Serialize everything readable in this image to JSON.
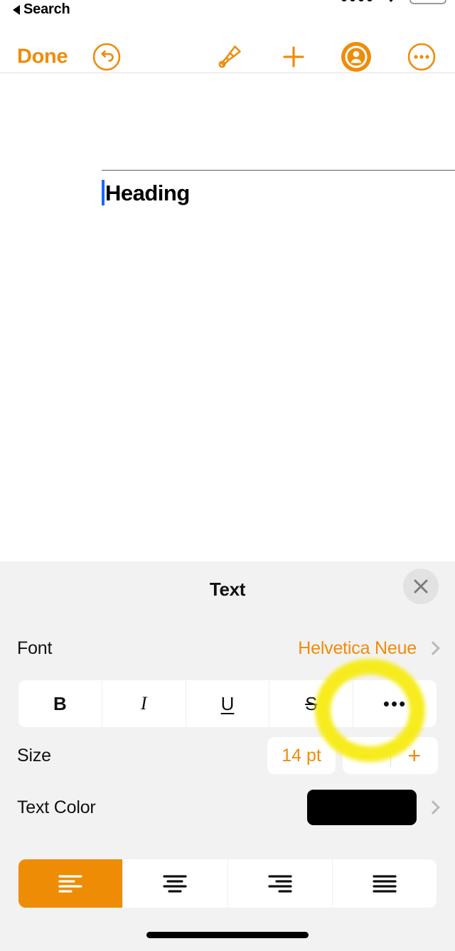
{
  "statusbar": {
    "back_label": "Search",
    "signal_icon": "signal-dots-icon",
    "wifi_icon": "wifi-arrow-icon",
    "battery_icon": "battery-icon"
  },
  "toolbar": {
    "done_label": "Done",
    "undo_icon": "undo-circle-icon",
    "brush_icon": "paintbrush-icon",
    "add_icon": "plus-icon",
    "account_icon": "account-circle-icon",
    "more_icon": "more-circle-icon"
  },
  "document": {
    "heading_text": "Heading",
    "cursor_color": "#1b66ff"
  },
  "panel": {
    "title": "Text",
    "close_icon": "close-icon",
    "font": {
      "label": "Font",
      "value": "Helvetica Neue",
      "chevron_icon": "chevron-right-icon"
    },
    "style_options": [
      {
        "label": "B",
        "name": "bold"
      },
      {
        "label": "I",
        "name": "italic"
      },
      {
        "label": "U",
        "name": "underline"
      },
      {
        "label": "S",
        "name": "strikethrough"
      },
      {
        "label": "•••",
        "name": "more-text-options"
      }
    ],
    "size": {
      "label": "Size",
      "value": "14 pt",
      "decrease_label": "−",
      "increase_label": "+"
    },
    "text_color": {
      "label": "Text Color",
      "swatch_color": "#000000",
      "chevron_icon": "chevron-right-icon"
    },
    "alignment": {
      "selected": "left",
      "options": [
        {
          "name": "align-left",
          "selected": true
        },
        {
          "name": "align-center",
          "selected": false
        },
        {
          "name": "align-right",
          "selected": false
        },
        {
          "name": "align-justify",
          "selected": false
        }
      ]
    }
  },
  "annotation": {
    "highlight_color": "#f7ec15",
    "target": "more-text-options"
  },
  "colors": {
    "accent_orange": "#ef8c09",
    "panel_background": "#f2f2f2",
    "card_white": "#ffffff"
  }
}
